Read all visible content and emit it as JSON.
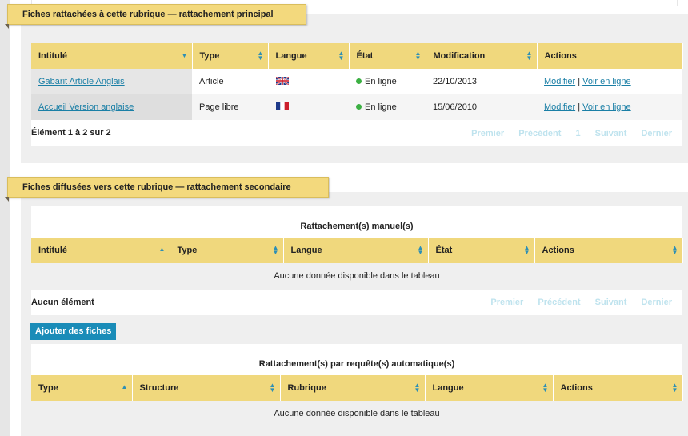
{
  "section1": {
    "tab_title": "Fiches rattachées à cette rubrique — rattachement principal",
    "table": {
      "headers": [
        "Intitulé",
        "Type",
        "Langue",
        "État",
        "Modification",
        "Actions"
      ],
      "rows": [
        {
          "title": "Gabarit Article Anglais",
          "type": "Article",
          "lang_icon": "uk-flag-icon",
          "state": "En ligne",
          "modified": "22/10/2013",
          "action_edit": "Modifier",
          "separator": "|",
          "action_view": "Voir en ligne"
        },
        {
          "title": "Accueil Version anglaise",
          "type": "Page libre",
          "lang_icon": "fr-flag-icon",
          "state": "En ligne",
          "modified": "15/06/2010",
          "action_edit": "Modifier",
          "separator": "|",
          "action_view": "Voir en ligne"
        }
      ]
    },
    "info": "Élément 1 à 2 sur 2",
    "pager": {
      "first": "Premier",
      "prev": "Précédent",
      "page": "1",
      "next": "Suivant",
      "last": "Dernier"
    }
  },
  "section2": {
    "tab_title": "Fiches diffusées vers cette rubrique — rattachement secondaire",
    "manual": {
      "caption": "Rattachement(s) manuel(s)",
      "headers": [
        "Intitulé",
        "Type",
        "Langue",
        "État",
        "Actions"
      ],
      "empty": "Aucune donnée disponible dans le tableau",
      "info": "Aucun élément",
      "pager": {
        "first": "Premier",
        "prev": "Précédent",
        "next": "Suivant",
        "last": "Dernier"
      }
    },
    "add_button": "Ajouter des fiches",
    "auto": {
      "caption": "Rattachement(s) par requête(s) automatique(s)",
      "headers": [
        "Type",
        "Structure",
        "Rubrique",
        "Langue",
        "Actions"
      ],
      "empty": "Aucune donnée disponible dans le tableau"
    }
  },
  "colors": {
    "tab": "#f3d97d",
    "header": "#f0d87d",
    "link": "#1a7fa6",
    "button": "#1a8cb8",
    "online": "#3cb043"
  }
}
